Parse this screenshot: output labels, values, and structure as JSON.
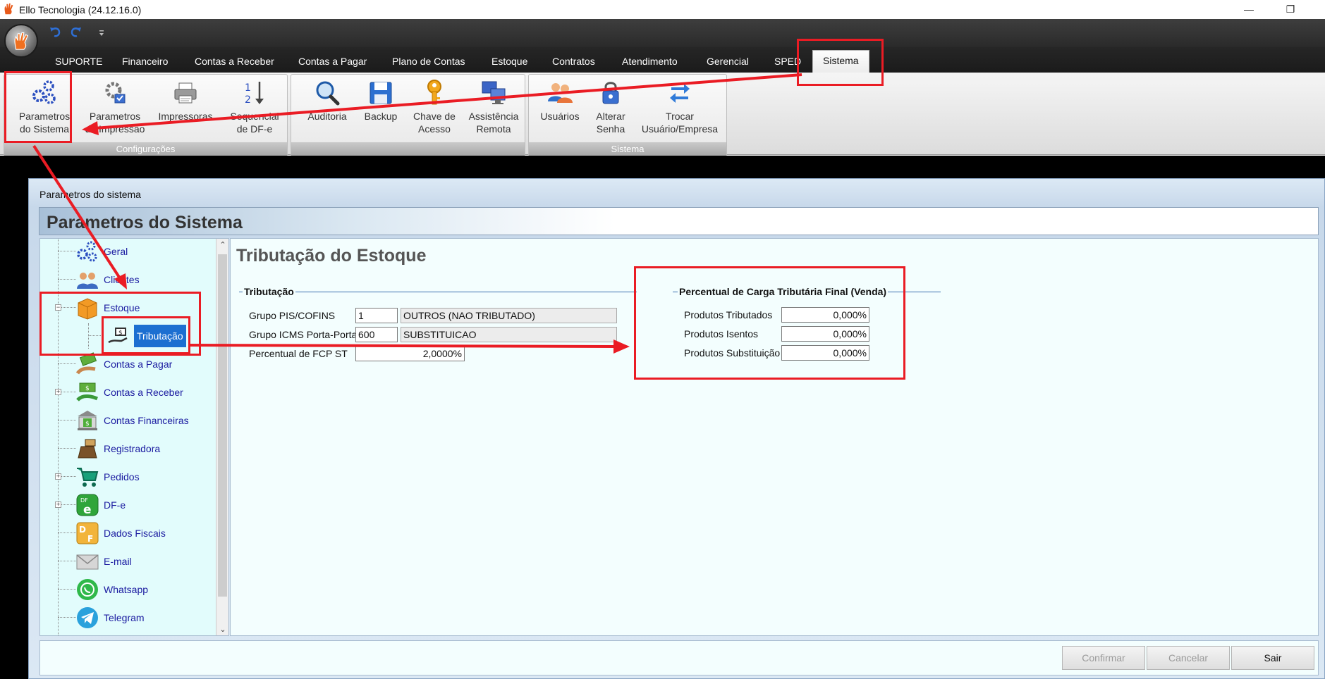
{
  "window": {
    "title": "Ello Tecnologia (24.12.16.0)",
    "minimize_glyph": "—",
    "restore_glyph": "❐"
  },
  "icons": {
    "app": "ello-hand-icon",
    "undo": "undo-icon",
    "redo": "redo-icon",
    "customize": "customize-quick-access-icon"
  },
  "tabs": [
    {
      "label": "SUPORTE"
    },
    {
      "label": "Financeiro"
    },
    {
      "label": "Contas a Receber"
    },
    {
      "label": "Contas a Pagar"
    },
    {
      "label": "Plano de Contas"
    },
    {
      "label": "Estoque"
    },
    {
      "label": "Contratos"
    },
    {
      "label": "Atendimento"
    },
    {
      "label": "Gerencial"
    },
    {
      "label": "SPED"
    },
    {
      "label": "Sistema",
      "active": true
    }
  ],
  "ribbon": {
    "groups": [
      {
        "caption": "Configurações",
        "buttons": [
          {
            "line1": "Parametros",
            "line2": "do Sistema",
            "icon": "gears-icon"
          },
          {
            "line1": "Parametros",
            "line2": "de Impressão",
            "icon": "gear-print-icon"
          },
          {
            "line1": "Impressoras",
            "line2": "",
            "icon": "printer-icon"
          },
          {
            "line1": "Sequencial",
            "line2": "de DF-e",
            "icon": "sort-numbers-icon"
          }
        ]
      },
      {
        "caption": "",
        "buttons": [
          {
            "line1": "Auditoria",
            "line2": "",
            "icon": "magnifier-icon"
          },
          {
            "line1": "Backup",
            "line2": "",
            "icon": "floppy-disk-icon"
          },
          {
            "line1": "Chave de",
            "line2": "Acesso",
            "icon": "key-icon"
          },
          {
            "line1": "Assistência",
            "line2": "Remota",
            "icon": "remote-desktop-icon"
          }
        ]
      },
      {
        "caption": "Sistema",
        "buttons": [
          {
            "line1": "Usuários",
            "line2": "",
            "icon": "users-icon"
          },
          {
            "line1": "Alterar",
            "line2": "Senha",
            "icon": "padlock-icon"
          },
          {
            "line1": "Trocar",
            "line2": "Usuário/Empresa",
            "icon": "swap-arrows-icon"
          }
        ]
      }
    ]
  },
  "dialog": {
    "title": "Parametros do sistema",
    "header": "Parametros do Sistema",
    "tree": [
      {
        "label": "Geral",
        "icon": "gears-icon",
        "expander": false
      },
      {
        "label": "Clientes",
        "icon": "people-icon",
        "expander": false
      },
      {
        "label": "Estoque",
        "icon": "box-icon",
        "expander": "−"
      },
      {
        "label": "Tributação",
        "icon": "tax-hand-icon",
        "expander": false,
        "selected": true
      },
      {
        "label": "Contas a Pagar",
        "icon": "money-hand-icon",
        "expander": false
      },
      {
        "label": "Contas a Receber",
        "icon": "money-receive-icon",
        "expander": "+"
      },
      {
        "label": "Contas Financeiras",
        "icon": "bank-icon",
        "expander": false
      },
      {
        "label": "Registradora",
        "icon": "cash-register-icon",
        "expander": false
      },
      {
        "label": "Pedidos",
        "icon": "cart-icon",
        "expander": "+"
      },
      {
        "label": "DF-e",
        "icon": "dfe-icon",
        "expander": "+"
      },
      {
        "label": "Dados Fiscais",
        "icon": "fiscal-data-icon",
        "expander": false
      },
      {
        "label": "E-mail",
        "icon": "envelope-icon",
        "expander": false
      },
      {
        "label": "Whatsapp",
        "icon": "whatsapp-icon",
        "expander": false
      },
      {
        "label": "Telegram",
        "icon": "telegram-icon",
        "expander": false
      }
    ],
    "scroll": {
      "up": "⌃",
      "down": "⌄"
    },
    "page_title": "Tributação do Estoque",
    "tributacao": {
      "title": "Tributação",
      "pis_label": "Grupo PIS/COFINS",
      "pis_code": "1",
      "pis_desc": "OUTROS (NAO TRIBUTADO)",
      "icms_label": "Grupo ICMS Porta-Porta",
      "icms_code": "600",
      "icms_desc": "SUBSTITUICAO",
      "fcp_label": "Percentual de FCP ST",
      "fcp_value": "2,0000%"
    },
    "carga": {
      "title": "Percentual de Carga Tributária Final (Venda)",
      "tributados_label": "Produtos Tributados",
      "tributados_value": "0,000%",
      "isentos_label": "Produtos Isentos",
      "isentos_value": "0,000%",
      "substituicao_label": "Produtos Substituição",
      "substituicao_value": "0,000%"
    },
    "buttons": {
      "confirmar": "Confirmar",
      "cancelar": "Cancelar",
      "sair": "Sair"
    }
  },
  "annotation_color": "#ea1c24",
  "accent_color": "#1c6fd1"
}
